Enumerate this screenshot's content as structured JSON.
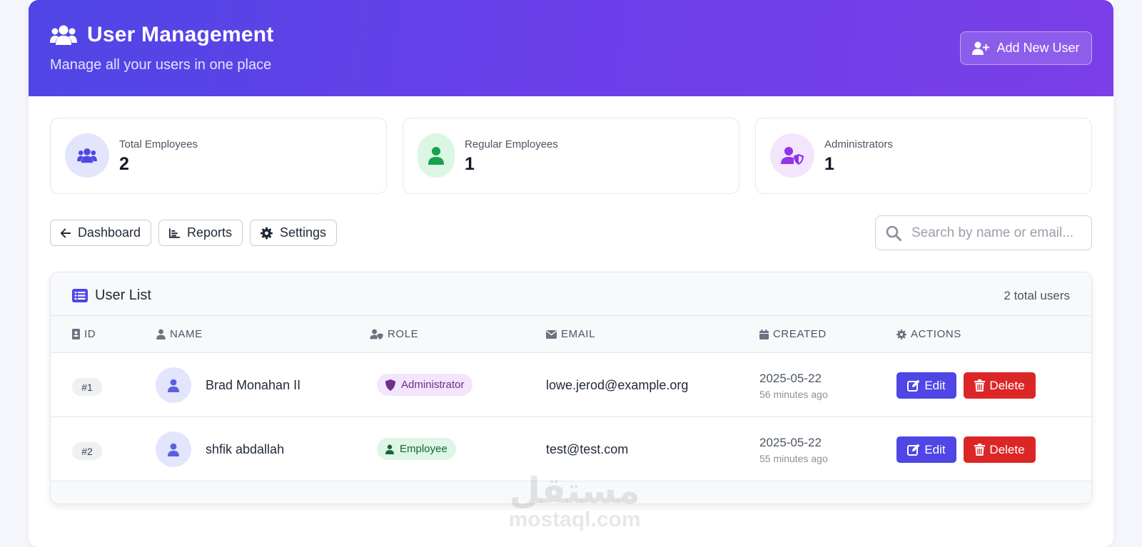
{
  "header": {
    "title": "User Management",
    "subtitle": "Manage all your users in one place",
    "add_button": "Add New User",
    "gradient": [
      "#4f46e5",
      "#7b3fe8"
    ]
  },
  "stats": [
    {
      "label": "Total Employees",
      "value": "2",
      "icon": "users-icon",
      "color": "#4f46e5",
      "bg": "#e2e5fb"
    },
    {
      "label": "Regular Employees",
      "value": "1",
      "icon": "user-icon",
      "color": "#16a34a",
      "bg": "#dcf6e4"
    },
    {
      "label": "Administrators",
      "value": "1",
      "icon": "user-shield-icon",
      "color": "#9333ea",
      "bg": "#f3e5fb"
    }
  ],
  "nav": {
    "dashboard": "Dashboard",
    "reports": "Reports",
    "settings": "Settings"
  },
  "search": {
    "placeholder": "Search by name or email...",
    "value": ""
  },
  "user_list": {
    "title": "User List",
    "count": "2 total users",
    "columns": [
      "ID",
      "NAME",
      "ROLE",
      "EMAIL",
      "CREATED",
      "ACTIONS"
    ],
    "rows": [
      {
        "id": "#1",
        "name": "Brad Monahan II",
        "role": "Administrator",
        "email": "lowe.jerod@example.org",
        "created": "2025-05-22",
        "ago": "56 minutes ago",
        "edit": "Edit",
        "delete": "Delete"
      },
      {
        "id": "#2",
        "name": "shfik abdallah",
        "role": "Employee",
        "email": "test@test.com",
        "created": "2025-05-22",
        "ago": "55 minutes ago",
        "edit": "Edit",
        "delete": "Delete"
      }
    ]
  },
  "watermark": {
    "arabic": "مستقل",
    "latin": "mostaql.com"
  }
}
